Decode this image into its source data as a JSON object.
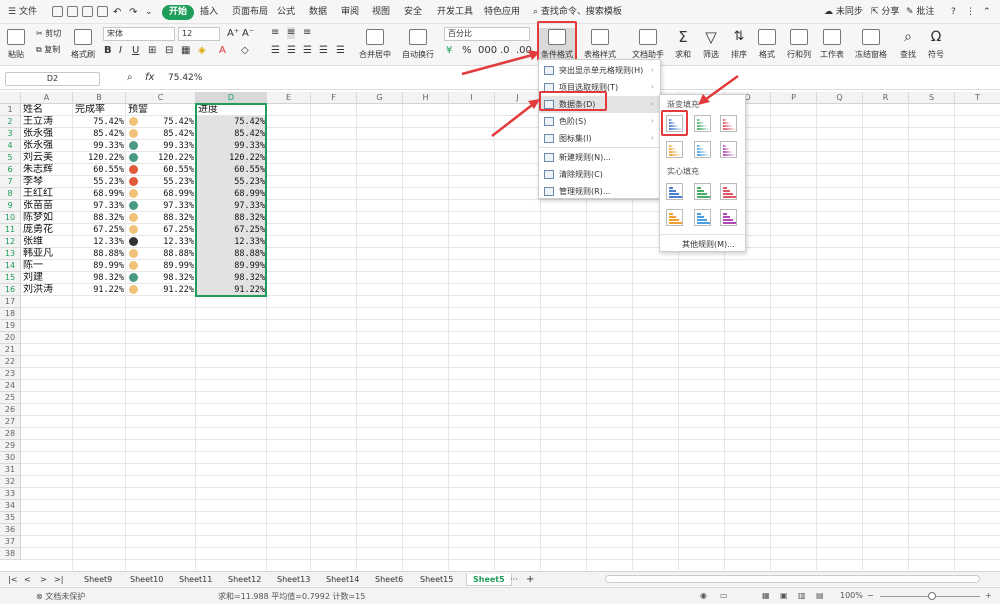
{
  "menubar": {
    "file_label": "文件",
    "tabs": [
      "开始",
      "插入",
      "页面布局",
      "公式",
      "数据",
      "审阅",
      "视图",
      "安全",
      "开发工具",
      "特色应用"
    ],
    "search_label": "查找命令、搜索模板",
    "sync_label": "未同步",
    "share_label": "分享",
    "comment_label": "批注"
  },
  "ribbon": {
    "paste": "粘贴",
    "cut": "剪切",
    "copy": "复制",
    "format_painter": "格式刷",
    "font_name": "宋体",
    "font_size": "12",
    "merge_center": "合并居中",
    "wrap_text": "自动换行",
    "number_format": "百分比",
    "conditional_format": "条件格式",
    "table_style": "表格样式",
    "doc_assistant": "文档助手",
    "sum": "求和",
    "filter": "筛选",
    "sort": "排序",
    "format": "格式",
    "row_col": "行和列",
    "worksheet": "工作表",
    "freeze": "冻结窗格",
    "find": "查找",
    "symbol": "符号"
  },
  "formula_bar": {
    "cell_ref": "D2",
    "fx": "fx",
    "value": "75.42%"
  },
  "columns": [
    "A",
    "B",
    "C",
    "D",
    "E",
    "F",
    "G",
    "H",
    "I",
    "J",
    "K",
    "L",
    "M",
    "N",
    "O",
    "P",
    "Q",
    "R",
    "S",
    "T"
  ],
  "headers": [
    "姓名",
    "完成率",
    "预警",
    "进度"
  ],
  "rows": [
    {
      "name": "王立涛",
      "rate": "75.42%",
      "dot": "#f2c27a"
    },
    {
      "name": "张永强",
      "rate": "85.42%",
      "dot": "#f2c27a"
    },
    {
      "name": "张永强",
      "rate": "99.33%",
      "dot": "#4a9a84"
    },
    {
      "name": "刘云美",
      "rate": "120.22%",
      "dot": "#4a9a84"
    },
    {
      "name": "朱志辉",
      "rate": "60.55%",
      "dot": "#e05a3a"
    },
    {
      "name": "李琴",
      "rate": "55.23%",
      "dot": "#e05a3a"
    },
    {
      "name": "王红红",
      "rate": "68.99%",
      "dot": "#f2c27a"
    },
    {
      "name": "张苗苗",
      "rate": "97.33%",
      "dot": "#4a9a84"
    },
    {
      "name": "陈梦如",
      "rate": "88.32%",
      "dot": "#f2c27a"
    },
    {
      "name": "庞勇花",
      "rate": "67.25%",
      "dot": "#f2c27a"
    },
    {
      "name": "张维",
      "rate": "12.33%",
      "dot": "#333333"
    },
    {
      "name": "韩亚凡",
      "rate": "88.88%",
      "dot": "#f2c27a"
    },
    {
      "name": "陈一",
      "rate": "89.99%",
      "dot": "#f2c27a"
    },
    {
      "name": "刘建",
      "rate": "98.32%",
      "dot": "#4a9a84"
    },
    {
      "name": "刘洪涛",
      "rate": "91.22%",
      "dot": "#f2c27a"
    }
  ],
  "row_count": 39,
  "cond_menu": {
    "items": [
      "突出显示单元格规则(H)",
      "项目选取规则(T)",
      "数据条(D)",
      "色阶(S)",
      "图标集(I)",
      "新建规则(N)...",
      "清除规则(C)",
      "管理规则(R)..."
    ]
  },
  "databar_menu": {
    "gradient_title": "渐变填充",
    "solid_title": "实心填充",
    "more": "其他规则(M)...",
    "colors": [
      "#4a7fd0",
      "#4aae6a",
      "#e0576a",
      "#f0a030",
      "#4aa0e0",
      "#b04ab0"
    ]
  },
  "sheets": [
    "Sheet9",
    "Sheet10",
    "Sheet11",
    "Sheet12",
    "Sheet13",
    "Sheet14",
    "Sheet6",
    "Sheet15",
    "Sheet5"
  ],
  "active_sheet": "Sheet5",
  "status": {
    "protect": "文档未保护",
    "stats": "求和=11.988  平均值=0.7992  计数=15",
    "zoom": "100%"
  },
  "colors": {
    "accent": "#1e9e5a",
    "highlight": "#e23b3b"
  }
}
